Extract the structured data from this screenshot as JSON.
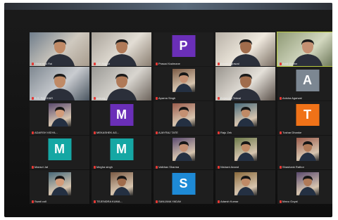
{
  "colors": {
    "letter_purple": "#6a2fb8",
    "letter_teal": "#15a7a4",
    "letter_blue": "#1e8ad6",
    "letter_orange": "#f07218",
    "letter_gray": "#7c8792",
    "speaker_outline": "#b8c93f",
    "muted_mic": "#e53935"
  },
  "participants": [
    {
      "name": "Himanshu Rai",
      "type": "video"
    },
    {
      "name": "T.P. Rajput",
      "type": "video"
    },
    {
      "name": "Prasad Kadmane",
      "type": "letter",
      "letter": "P",
      "color": "letter_purple"
    },
    {
      "name": "Anush Agrawal",
      "type": "video"
    },
    {
      "name": "Amit Gurme",
      "type": "video",
      "speaker": true
    },
    {
      "name": "B.S. PARIHAR",
      "type": "video"
    },
    {
      "name": "ankurg",
      "type": "video"
    },
    {
      "name": "Aparna Singh",
      "type": "photo"
    },
    {
      "name": "Anjanuka Tetwal",
      "type": "video"
    },
    {
      "name": "Anisha Agarwal",
      "type": "letter",
      "letter": "A",
      "color": "letter_gray"
    },
    {
      "name": "ADARSH VIDYA...",
      "type": "photo"
    },
    {
      "name": "MEKASHEK AG...",
      "type": "letter",
      "letter": "M",
      "color": "letter_purple"
    },
    {
      "name": "AJAYRAJ TATE",
      "type": "photo"
    },
    {
      "name": "Raju Zek",
      "type": "photo"
    },
    {
      "name": "Tushar Dhanke",
      "type": "letter",
      "letter": "T",
      "color": "letter_orange"
    },
    {
      "name": "Mansvi Jat",
      "type": "letter",
      "letter": "M",
      "color": "letter_teal"
    },
    {
      "name": "Megha singh",
      "type": "letter",
      "letter": "M",
      "color": "letter_teal"
    },
    {
      "name": "Vaibhav Sharma",
      "type": "photo"
    },
    {
      "name": "Nishant Anand",
      "type": "photo"
    },
    {
      "name": "Shashank Rathor",
      "type": "photo"
    },
    {
      "name": "Swati coll",
      "type": "photo"
    },
    {
      "name": "TEJENDRA KUMA...",
      "type": "photo"
    },
    {
      "name": "SANJANA YADAV",
      "type": "letter",
      "letter": "S",
      "color": "letter_blue"
    },
    {
      "name": "Adarsh Kumar",
      "type": "photo"
    },
    {
      "name": "Manu Goyal",
      "type": "photo"
    }
  ]
}
